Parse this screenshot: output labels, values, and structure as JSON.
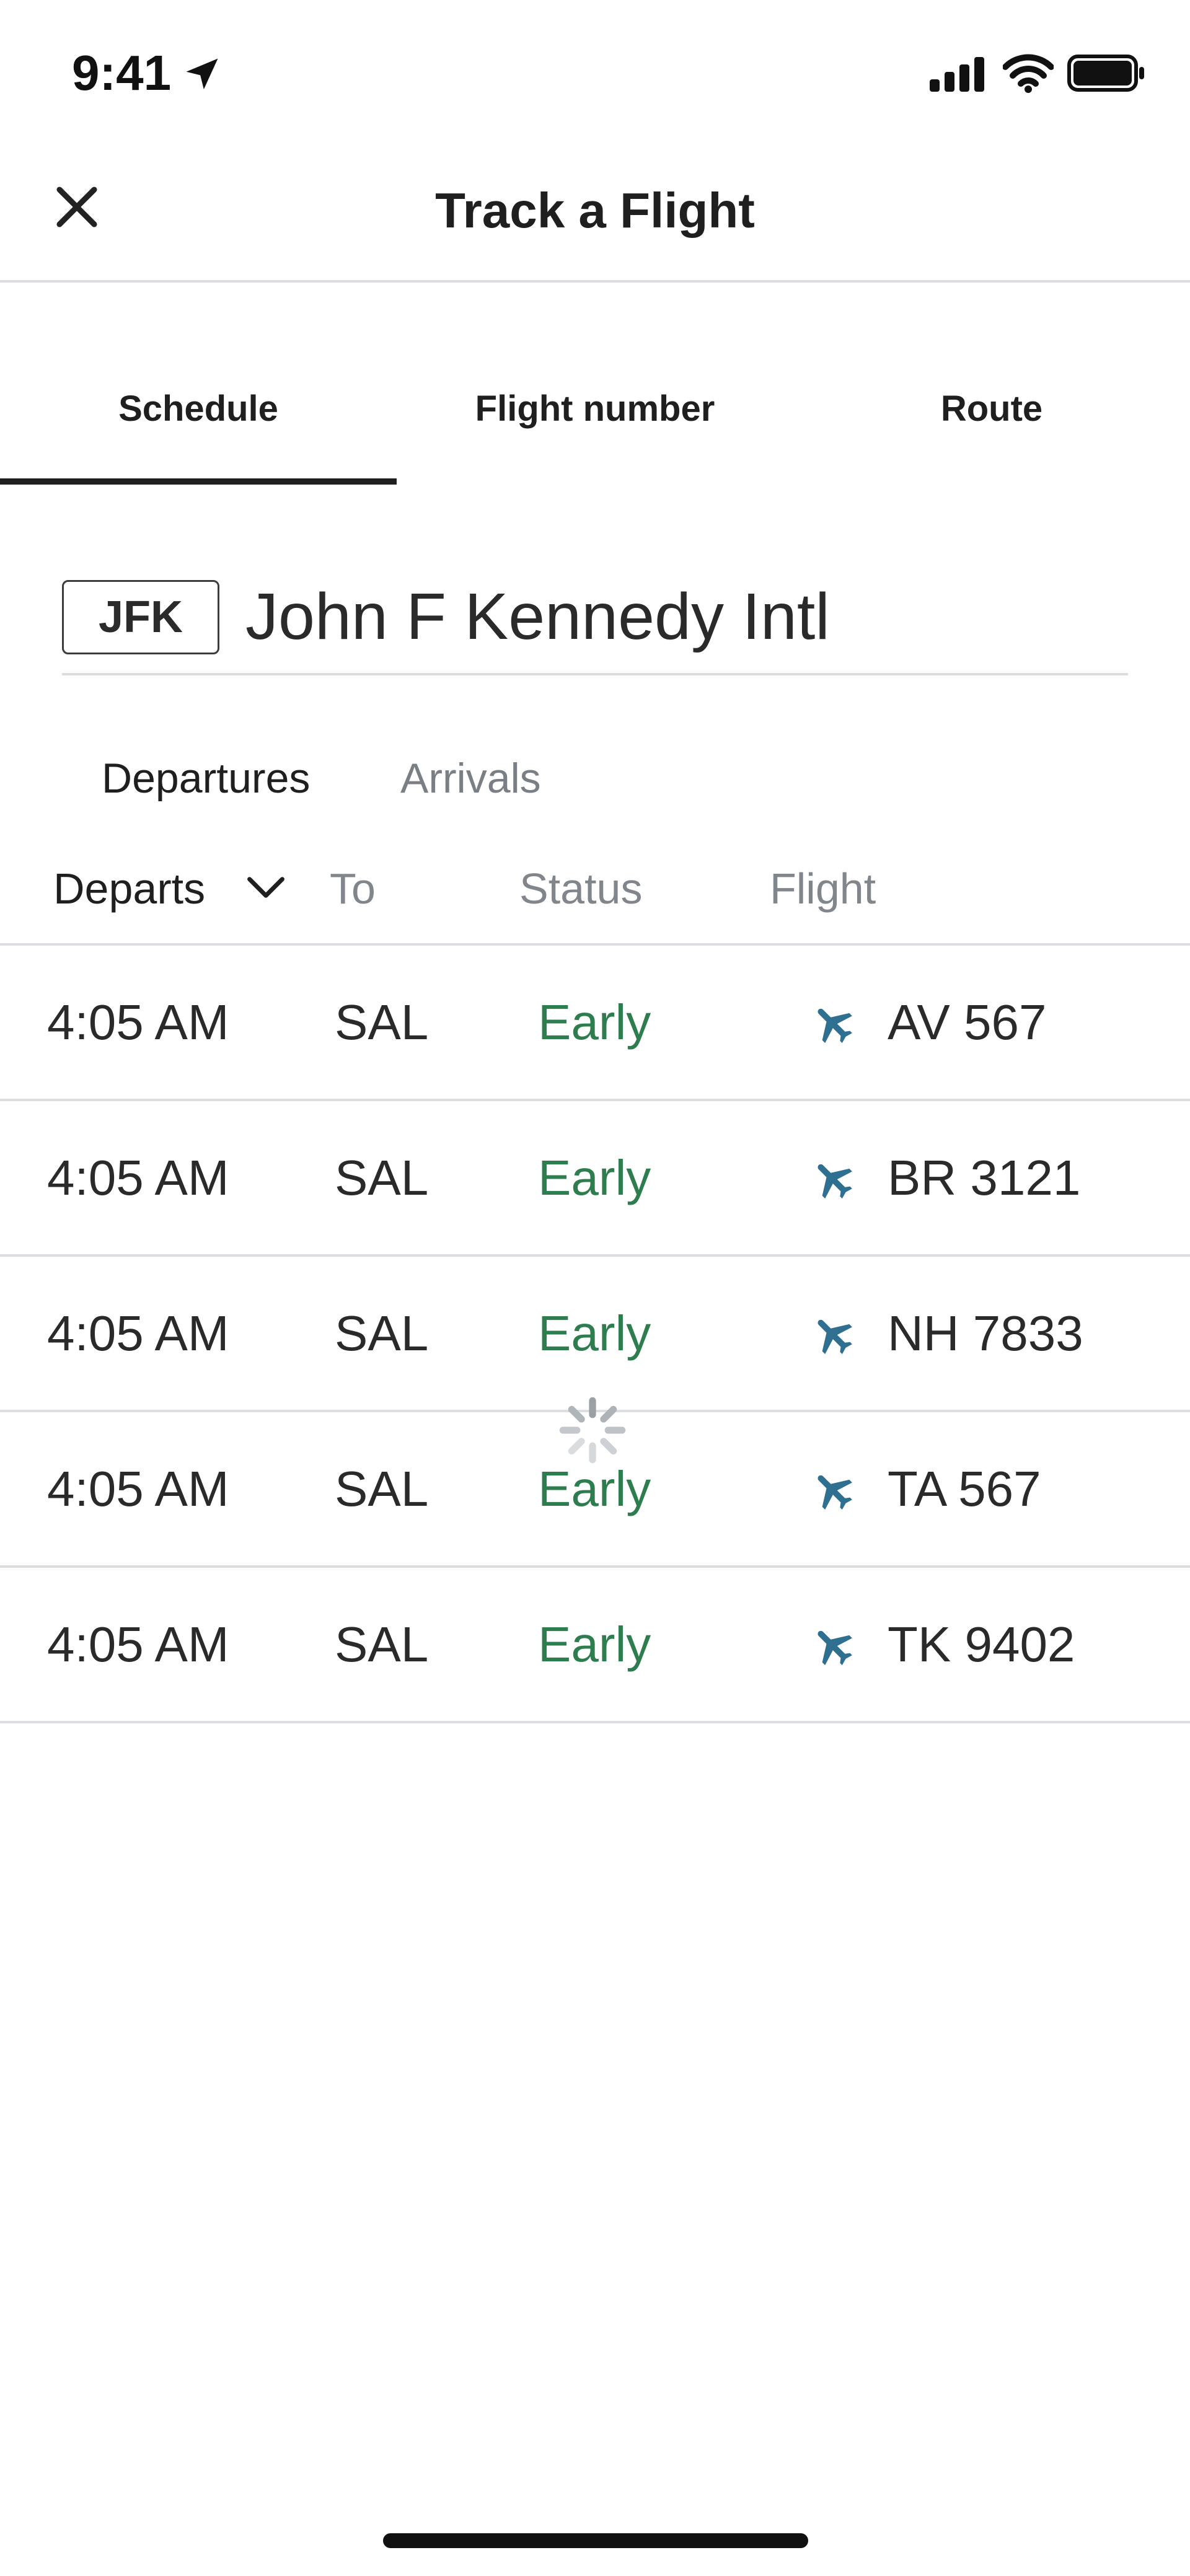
{
  "status_bar": {
    "time": "9:41",
    "icons": [
      "location-arrow-icon",
      "cellular-signal-icon",
      "wifi-icon",
      "battery-icon"
    ]
  },
  "header": {
    "title": "Track a Flight",
    "close_icon": "close-icon"
  },
  "tabs": [
    {
      "label": "Schedule",
      "selected": true
    },
    {
      "label": "Flight number",
      "selected": false
    },
    {
      "label": "Route",
      "selected": false
    }
  ],
  "airport": {
    "code": "JFK",
    "name": "John F Kennedy Intl"
  },
  "direction_tabs": [
    {
      "label": "Departures",
      "selected": true
    },
    {
      "label": "Arrivals",
      "selected": false
    }
  ],
  "columns": {
    "departs": "Departs",
    "to": "To",
    "status": "Status",
    "flight": "Flight"
  },
  "flights": [
    {
      "time": "4:05 AM",
      "dest": "SAL",
      "status": "Early",
      "flight": "AV 567"
    },
    {
      "time": "4:05 AM",
      "dest": "SAL",
      "status": "Early",
      "flight": "BR 3121"
    },
    {
      "time": "4:05 AM",
      "dest": "SAL",
      "status": "Early",
      "flight": "NH 7833"
    },
    {
      "time": "4:05 AM",
      "dest": "SAL",
      "status": "Early",
      "flight": "TA 567"
    },
    {
      "time": "4:05 AM",
      "dest": "SAL",
      "status": "Early",
      "flight": "TK 9402"
    }
  ],
  "colors": {
    "status_early": "#2e7d4f",
    "plane_icon": "#2f6f8f",
    "divider": "#dadde1",
    "muted_text": "#80868b"
  }
}
